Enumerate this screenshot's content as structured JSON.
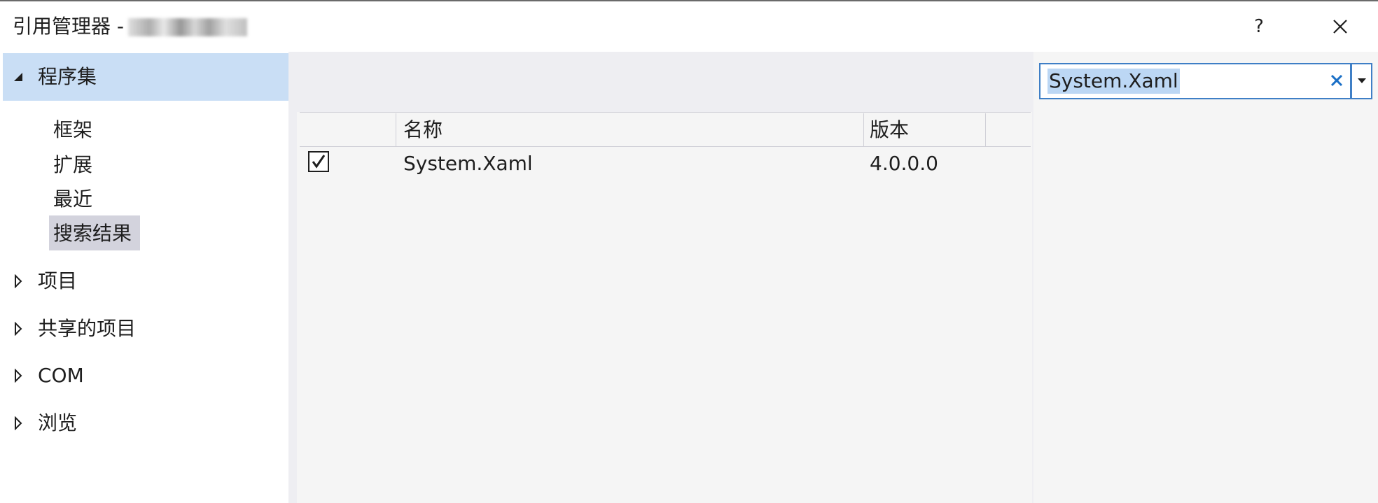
{
  "window": {
    "title": "引用管理器 -"
  },
  "titlebar": {
    "help_label": "?"
  },
  "nav": {
    "assemblies_label": "程序集",
    "sub_items": [
      "框架",
      "扩展",
      "最近",
      "搜索结果"
    ],
    "projects_label": "项目",
    "shared_projects_label": "共享的项目",
    "com_label": "COM",
    "browse_label": "浏览"
  },
  "table": {
    "headers": {
      "name": "名称",
      "version": "版本"
    },
    "rows": [
      {
        "checked": true,
        "name": "System.Xaml",
        "version": "4.0.0.0"
      }
    ]
  },
  "search": {
    "value": "System.Xaml"
  },
  "colors": {
    "selected_nav_bg": "#c9def5",
    "selected_subitem_bg": "#d3d3dd",
    "search_border": "#3f7fc6",
    "search_highlight": "#bcd7f4",
    "clear_icon": "#1a6fc6"
  }
}
